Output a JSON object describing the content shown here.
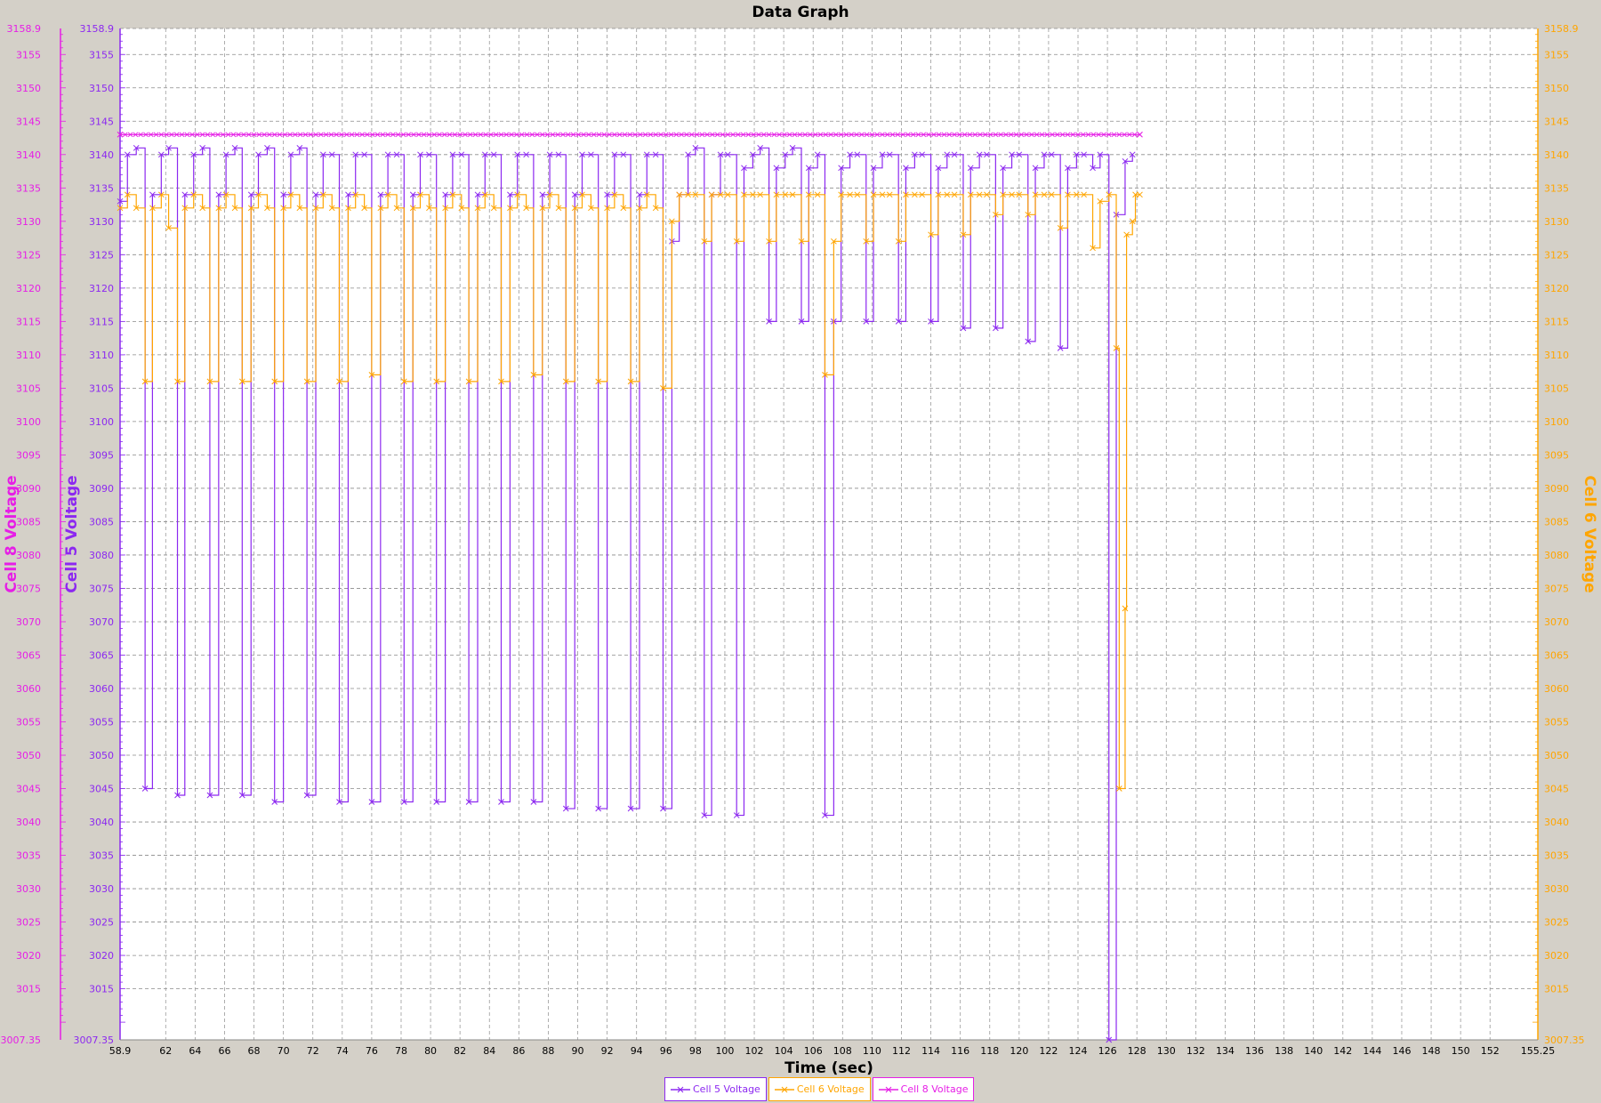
{
  "chart_data": {
    "type": "line",
    "title": "Data Graph",
    "xlabel": "Time (sec)",
    "xlim": [
      58.9,
      155.25
    ],
    "x_ticks": [
      58.9,
      62,
      64,
      66,
      68,
      70,
      72,
      74,
      76,
      78,
      80,
      82,
      84,
      86,
      88,
      90,
      92,
      94,
      96,
      98,
      100,
      102,
      104,
      106,
      108,
      110,
      112,
      114,
      116,
      118,
      120,
      122,
      124,
      126,
      128,
      130,
      132,
      134,
      136,
      138,
      140,
      142,
      144,
      146,
      148,
      150,
      152,
      155.25
    ],
    "y_axes": [
      {
        "id": "cell8",
        "label": "Cell 8 Voltage",
        "color": "#e61ee6",
        "ylim": [
          3007.35,
          3158.9
        ],
        "side": "left-outer"
      },
      {
        "id": "cell5",
        "label": "Cell 5 Voltage",
        "color": "#8c28f0",
        "ylim": [
          3007.35,
          3158.9
        ],
        "side": "left-inner"
      },
      {
        "id": "cell6",
        "label": "Cell 6 Voltage",
        "color": "#ffa500",
        "ylim": [
          3007.35,
          3158.9
        ],
        "side": "right"
      }
    ],
    "y_ticks_left_outer": [
      3158.9,
      3155,
      3150,
      3145,
      3140,
      3135,
      3130,
      3125,
      3120,
      3115,
      3110,
      3105,
      3100,
      3095,
      3090,
      3085,
      3080,
      3075,
      3070,
      3065,
      3060,
      3055,
      3050,
      3045,
      3040,
      3035,
      3030,
      3025,
      3020,
      3015,
      3007.35
    ],
    "y_ticks_left_inner": [
      3158.9,
      3155,
      3150,
      3145,
      3140,
      3135,
      3130,
      3125,
      3120,
      3115,
      3110,
      3105,
      3100,
      3095,
      3090,
      3085,
      3080,
      3075,
      3070,
      3065,
      3060,
      3055,
      3050,
      3045,
      3040,
      3035,
      3030,
      3025,
      3020,
      3015,
      3007.35
    ],
    "y_ticks_right": [
      3158.9,
      3155,
      3150,
      3145,
      3140,
      3135,
      3130,
      3125,
      3120,
      3115,
      3110,
      3105,
      3100,
      3095,
      3090,
      3085,
      3080,
      3075,
      3070,
      3065,
      3060,
      3055,
      3050,
      3045,
      3040,
      3035,
      3030,
      3025,
      3020,
      3015,
      3007.35
    ],
    "grid": true,
    "legend_position": "bottom-center",
    "series": [
      {
        "name": "Cell 5 Voltage",
        "axis": "cell5",
        "color": "#8c28f0",
        "points": [
          [
            58.9,
            3133
          ],
          [
            59.4,
            3140
          ],
          [
            60.0,
            3141
          ],
          [
            60.6,
            3045
          ],
          [
            61.1,
            3134
          ],
          [
            61.7,
            3140
          ],
          [
            62.2,
            3141
          ],
          [
            62.8,
            3044
          ],
          [
            63.3,
            3134
          ],
          [
            63.9,
            3140
          ],
          [
            64.5,
            3141
          ],
          [
            65.0,
            3044
          ],
          [
            65.6,
            3134
          ],
          [
            66.1,
            3140
          ],
          [
            66.7,
            3141
          ],
          [
            67.2,
            3044
          ],
          [
            67.8,
            3134
          ],
          [
            68.3,
            3140
          ],
          [
            68.9,
            3141
          ],
          [
            69.4,
            3043
          ],
          [
            70.0,
            3134
          ],
          [
            70.5,
            3140
          ],
          [
            71.1,
            3141
          ],
          [
            71.6,
            3044
          ],
          [
            72.2,
            3134
          ],
          [
            72.7,
            3140
          ],
          [
            73.3,
            3140
          ],
          [
            73.8,
            3043
          ],
          [
            74.4,
            3134
          ],
          [
            74.9,
            3140
          ],
          [
            75.5,
            3140
          ],
          [
            76.0,
            3043
          ],
          [
            76.6,
            3134
          ],
          [
            77.1,
            3140
          ],
          [
            77.7,
            3140
          ],
          [
            78.2,
            3043
          ],
          [
            78.8,
            3134
          ],
          [
            79.3,
            3140
          ],
          [
            79.9,
            3140
          ],
          [
            80.4,
            3043
          ],
          [
            81.0,
            3134
          ],
          [
            81.5,
            3140
          ],
          [
            82.1,
            3140
          ],
          [
            82.6,
            3043
          ],
          [
            83.2,
            3134
          ],
          [
            83.7,
            3140
          ],
          [
            84.3,
            3140
          ],
          [
            84.8,
            3043
          ],
          [
            85.4,
            3134
          ],
          [
            85.9,
            3140
          ],
          [
            86.5,
            3140
          ],
          [
            87.0,
            3043
          ],
          [
            87.6,
            3134
          ],
          [
            88.1,
            3140
          ],
          [
            88.7,
            3140
          ],
          [
            89.2,
            3042
          ],
          [
            89.8,
            3134
          ],
          [
            90.3,
            3140
          ],
          [
            90.9,
            3140
          ],
          [
            91.4,
            3042
          ],
          [
            92.0,
            3134
          ],
          [
            92.5,
            3140
          ],
          [
            93.1,
            3140
          ],
          [
            93.6,
            3042
          ],
          [
            94.2,
            3134
          ],
          [
            94.7,
            3140
          ],
          [
            95.3,
            3140
          ],
          [
            95.8,
            3042
          ],
          [
            96.4,
            3127
          ],
          [
            96.9,
            3134
          ],
          [
            97.5,
            3140
          ],
          [
            98.0,
            3141
          ],
          [
            98.6,
            3041
          ],
          [
            99.1,
            3134
          ],
          [
            99.7,
            3140
          ],
          [
            100.2,
            3140
          ],
          [
            100.8,
            3041
          ],
          [
            101.3,
            3138
          ],
          [
            101.9,
            3140
          ],
          [
            102.4,
            3141
          ],
          [
            103.0,
            3115
          ],
          [
            103.5,
            3138
          ],
          [
            104.1,
            3140
          ],
          [
            104.6,
            3141
          ],
          [
            105.2,
            3115
          ],
          [
            105.7,
            3138
          ],
          [
            106.3,
            3140
          ],
          [
            106.8,
            3041
          ],
          [
            107.4,
            3115
          ],
          [
            107.9,
            3138
          ],
          [
            108.5,
            3140
          ],
          [
            109.0,
            3140
          ],
          [
            109.6,
            3115
          ],
          [
            110.1,
            3138
          ],
          [
            110.7,
            3140
          ],
          [
            111.2,
            3140
          ],
          [
            111.8,
            3115
          ],
          [
            112.3,
            3138
          ],
          [
            112.9,
            3140
          ],
          [
            113.4,
            3140
          ],
          [
            114.0,
            3115
          ],
          [
            114.5,
            3138
          ],
          [
            115.1,
            3140
          ],
          [
            115.6,
            3140
          ],
          [
            116.2,
            3114
          ],
          [
            116.7,
            3138
          ],
          [
            117.3,
            3140
          ],
          [
            117.8,
            3140
          ],
          [
            118.4,
            3114
          ],
          [
            118.9,
            3138
          ],
          [
            119.5,
            3140
          ],
          [
            120.0,
            3140
          ],
          [
            120.6,
            3112
          ],
          [
            121.1,
            3138
          ],
          [
            121.7,
            3140
          ],
          [
            122.2,
            3140
          ],
          [
            122.8,
            3111
          ],
          [
            123.3,
            3138
          ],
          [
            123.9,
            3140
          ],
          [
            124.4,
            3140
          ],
          [
            125.0,
            3138
          ],
          [
            125.5,
            3140
          ],
          [
            126.1,
            3007.35
          ],
          [
            126.6,
            3131
          ],
          [
            127.2,
            3139
          ],
          [
            127.7,
            3140
          ]
        ]
      },
      {
        "name": "Cell 6 Voltage",
        "axis": "cell6",
        "color": "#ffa500",
        "points": [
          [
            58.9,
            3132
          ],
          [
            59.4,
            3134
          ],
          [
            60.0,
            3132
          ],
          [
            60.6,
            3106
          ],
          [
            61.1,
            3132
          ],
          [
            61.7,
            3134
          ],
          [
            62.2,
            3129
          ],
          [
            62.8,
            3106
          ],
          [
            63.3,
            3132
          ],
          [
            63.9,
            3134
          ],
          [
            64.5,
            3132
          ],
          [
            65.0,
            3106
          ],
          [
            65.6,
            3132
          ],
          [
            66.1,
            3134
          ],
          [
            66.7,
            3132
          ],
          [
            67.2,
            3106
          ],
          [
            67.8,
            3132
          ],
          [
            68.3,
            3134
          ],
          [
            68.9,
            3132
          ],
          [
            69.4,
            3106
          ],
          [
            70.0,
            3132
          ],
          [
            70.5,
            3134
          ],
          [
            71.1,
            3132
          ],
          [
            71.6,
            3106
          ],
          [
            72.2,
            3132
          ],
          [
            72.7,
            3134
          ],
          [
            73.3,
            3132
          ],
          [
            73.8,
            3106
          ],
          [
            74.4,
            3132
          ],
          [
            74.9,
            3134
          ],
          [
            75.5,
            3132
          ],
          [
            76.0,
            3107
          ],
          [
            76.6,
            3132
          ],
          [
            77.1,
            3134
          ],
          [
            77.7,
            3132
          ],
          [
            78.2,
            3106
          ],
          [
            78.8,
            3132
          ],
          [
            79.3,
            3134
          ],
          [
            79.9,
            3132
          ],
          [
            80.4,
            3106
          ],
          [
            81.0,
            3132
          ],
          [
            81.5,
            3134
          ],
          [
            82.1,
            3132
          ],
          [
            82.6,
            3106
          ],
          [
            83.2,
            3132
          ],
          [
            83.7,
            3134
          ],
          [
            84.3,
            3132
          ],
          [
            84.8,
            3106
          ],
          [
            85.4,
            3132
          ],
          [
            85.9,
            3134
          ],
          [
            86.5,
            3132
          ],
          [
            87.0,
            3107
          ],
          [
            87.6,
            3132
          ],
          [
            88.1,
            3134
          ],
          [
            88.7,
            3132
          ],
          [
            89.2,
            3106
          ],
          [
            89.8,
            3132
          ],
          [
            90.3,
            3134
          ],
          [
            90.9,
            3132
          ],
          [
            91.4,
            3106
          ],
          [
            92.0,
            3132
          ],
          [
            92.5,
            3134
          ],
          [
            93.1,
            3132
          ],
          [
            93.6,
            3106
          ],
          [
            94.2,
            3132
          ],
          [
            94.7,
            3134
          ],
          [
            95.3,
            3132
          ],
          [
            95.8,
            3105
          ],
          [
            96.4,
            3130
          ],
          [
            96.9,
            3134
          ],
          [
            97.5,
            3134
          ],
          [
            98.0,
            3134
          ],
          [
            98.6,
            3127
          ],
          [
            99.1,
            3134
          ],
          [
            99.7,
            3134
          ],
          [
            100.2,
            3134
          ],
          [
            100.8,
            3127
          ],
          [
            101.3,
            3134
          ],
          [
            101.9,
            3134
          ],
          [
            102.4,
            3134
          ],
          [
            103.0,
            3127
          ],
          [
            103.5,
            3134
          ],
          [
            104.1,
            3134
          ],
          [
            104.6,
            3134
          ],
          [
            105.2,
            3127
          ],
          [
            105.7,
            3134
          ],
          [
            106.3,
            3134
          ],
          [
            106.8,
            3107
          ],
          [
            107.4,
            3127
          ],
          [
            107.9,
            3134
          ],
          [
            108.5,
            3134
          ],
          [
            109.0,
            3134
          ],
          [
            109.6,
            3127
          ],
          [
            110.1,
            3134
          ],
          [
            110.7,
            3134
          ],
          [
            111.2,
            3134
          ],
          [
            111.8,
            3127
          ],
          [
            112.3,
            3134
          ],
          [
            112.9,
            3134
          ],
          [
            113.4,
            3134
          ],
          [
            114.0,
            3128
          ],
          [
            114.5,
            3134
          ],
          [
            115.1,
            3134
          ],
          [
            115.6,
            3134
          ],
          [
            116.2,
            3128
          ],
          [
            116.7,
            3134
          ],
          [
            117.3,
            3134
          ],
          [
            117.8,
            3134
          ],
          [
            118.4,
            3131
          ],
          [
            118.9,
            3134
          ],
          [
            119.5,
            3134
          ],
          [
            120.0,
            3134
          ],
          [
            120.6,
            3131
          ],
          [
            121.1,
            3134
          ],
          [
            121.7,
            3134
          ],
          [
            122.2,
            3134
          ],
          [
            122.8,
            3129
          ],
          [
            123.3,
            3134
          ],
          [
            123.9,
            3134
          ],
          [
            124.4,
            3134
          ],
          [
            125.0,
            3126
          ],
          [
            125.5,
            3133
          ],
          [
            126.1,
            3134
          ],
          [
            126.6,
            3111
          ],
          [
            127.2,
            3072
          ],
          [
            127.7,
            3130
          ],
          [
            128.2,
            3134
          ],
          [
            126.8,
            3045
          ],
          [
            127.3,
            3128
          ],
          [
            127.9,
            3134
          ]
        ]
      },
      {
        "name": "Cell 8 Voltage",
        "axis": "cell8",
        "color": "#e61ee6",
        "points": [
          [
            58.9,
            3143
          ],
          [
            128.2,
            3143
          ]
        ]
      }
    ]
  },
  "legend": {
    "items": [
      {
        "label": "Cell 5 Voltage",
        "color": "#8c28f0"
      },
      {
        "label": "Cell 6 Voltage",
        "color": "#ffa500"
      },
      {
        "label": "Cell 8 Voltage",
        "color": "#e61ee6"
      }
    ]
  }
}
